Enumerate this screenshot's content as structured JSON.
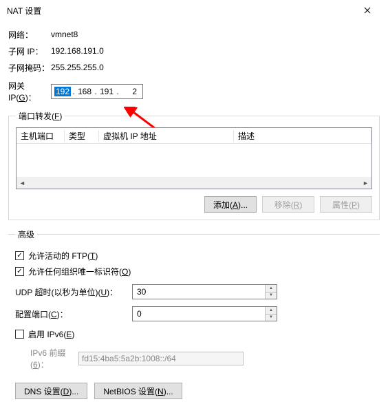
{
  "title": "NAT 设置",
  "info": {
    "network_label": "网络：",
    "network_value": "vmnet8",
    "subnet_label": "子网 IP：",
    "subnet_value": "192.168.191.0",
    "mask_label": "子网掩码：",
    "mask_value": "255.255.255.0"
  },
  "gateway": {
    "label": "网关 IP(G)：",
    "seg1": "192",
    "seg2": "168",
    "seg3": "191",
    "seg4": "2"
  },
  "port_forward": {
    "legend": "端口转发(F)",
    "headers": {
      "host_port": "主机端口",
      "type": "类型",
      "vm_ip": "虚拟机 IP 地址",
      "desc": "描述"
    },
    "buttons": {
      "add": "添加(A)...",
      "remove": "移除(R)",
      "props": "属性(P)"
    }
  },
  "advanced": {
    "legend": "高级",
    "allow_ftp": "允许活动的 FTP(T)",
    "allow_oui": "允许任何组织唯一标识符(O)",
    "udp_timeout_label": "UDP 超时(以秒为单位)(U)：",
    "udp_timeout_value": "30",
    "config_port_label": "配置端口(C)：",
    "config_port_value": "0",
    "enable_ipv6": "启用 IPv6(E)",
    "ipv6_prefix_label": "IPv6 前缀(6)：",
    "ipv6_prefix_value": "fd15:4ba5:5a2b:1008::/64",
    "dns_btn": "DNS 设置(D)...",
    "netbios_btn": "NetBIOS 设置(N)..."
  }
}
